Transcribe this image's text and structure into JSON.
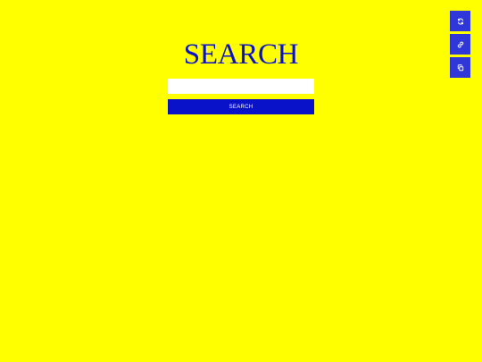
{
  "search": {
    "title": "SEARCH",
    "input_value": "",
    "input_placeholder": "",
    "button_label": "SEARCH"
  },
  "side_actions": [
    {
      "icon": "refresh-icon"
    },
    {
      "icon": "link-icon"
    },
    {
      "icon": "copy-icon"
    }
  ],
  "colors": {
    "background": "#ffff00",
    "accent": "#0a12c9",
    "side_button": "#2f37d9",
    "input_background": "#ffffff"
  }
}
